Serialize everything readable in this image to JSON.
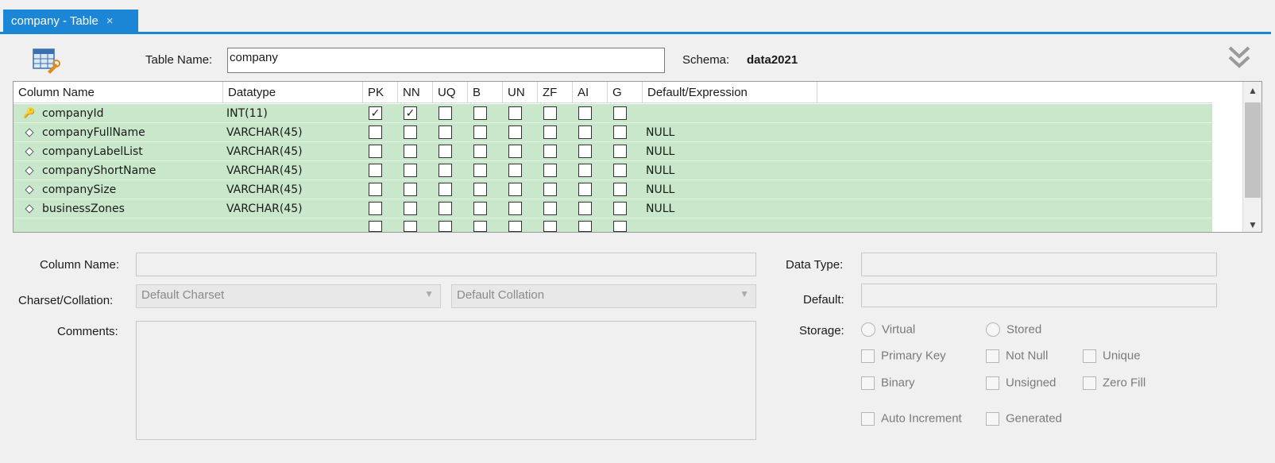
{
  "tab": {
    "label": "company - Table",
    "close": "×"
  },
  "header": {
    "table_name_label": "Table Name:",
    "table_name_value": "company",
    "schema_label": "Schema:",
    "schema_value": "data2021"
  },
  "grid": {
    "columns": [
      "Column Name",
      "Datatype",
      "PK",
      "NN",
      "UQ",
      "B",
      "UN",
      "ZF",
      "AI",
      "G",
      "Default/Expression"
    ],
    "rows": [
      {
        "name": "companyId",
        "type": "INT(11)",
        "key": true,
        "pk": true,
        "nn": true,
        "default": ""
      },
      {
        "name": "companyFullName",
        "type": "VARCHAR(45)",
        "key": false,
        "pk": false,
        "nn": false,
        "default": "NULL"
      },
      {
        "name": "companyLabelList",
        "type": "VARCHAR(45)",
        "key": false,
        "pk": false,
        "nn": false,
        "default": "NULL"
      },
      {
        "name": "companyShortName",
        "type": "VARCHAR(45)",
        "key": false,
        "pk": false,
        "nn": false,
        "default": "NULL"
      },
      {
        "name": "companySize",
        "type": "VARCHAR(45)",
        "key": false,
        "pk": false,
        "nn": false,
        "default": "NULL"
      },
      {
        "name": "businessZones",
        "type": "VARCHAR(45)",
        "key": false,
        "pk": false,
        "nn": false,
        "default": "NULL"
      }
    ]
  },
  "details": {
    "column_name_label": "Column Name:",
    "charset_label": "Charset/Collation:",
    "charset_value": "Default Charset",
    "collation_value": "Default Collation",
    "comments_label": "Comments:",
    "data_type_label": "Data Type:",
    "default_label": "Default:",
    "storage_label": "Storage:",
    "storage_virtual": "Virtual",
    "storage_stored": "Stored",
    "primary_key": "Primary Key",
    "not_null": "Not Null",
    "unique": "Unique",
    "binary": "Binary",
    "unsigned": "Unsigned",
    "zero_fill": "Zero Fill",
    "auto_increment": "Auto Increment",
    "generated": "Generated"
  }
}
